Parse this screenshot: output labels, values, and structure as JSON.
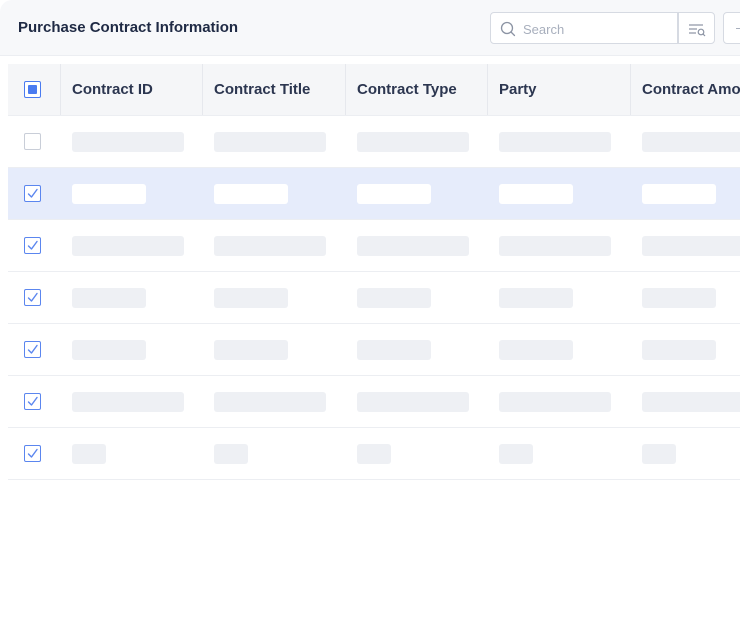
{
  "header": {
    "title": "Purchase Contract Information",
    "search_placeholder": "Search"
  },
  "table": {
    "columns": [
      "Contract ID",
      "Contract Title",
      "Contract Type",
      "Party",
      "Contract Amount"
    ],
    "select_all_state": "indeterminate",
    "rows": [
      {
        "checked": false,
        "selected": false,
        "placeholder_size": "long"
      },
      {
        "checked": true,
        "selected": true,
        "placeholder_size": "mid"
      },
      {
        "checked": true,
        "selected": false,
        "placeholder_size": "long"
      },
      {
        "checked": true,
        "selected": false,
        "placeholder_size": "mid"
      },
      {
        "checked": true,
        "selected": false,
        "placeholder_size": "mid"
      },
      {
        "checked": true,
        "selected": false,
        "placeholder_size": "long"
      },
      {
        "checked": true,
        "selected": false,
        "placeholder_size": "short"
      }
    ]
  },
  "colors": {
    "accent": "#4a7bf0",
    "selected_row": "#e6ecfb",
    "skeleton": "#eef0f4",
    "header_bg": "#f7f8fa"
  },
  "icons": {
    "search": "search-icon",
    "filter": "filter-search-icon",
    "more": "more-options-icon"
  }
}
